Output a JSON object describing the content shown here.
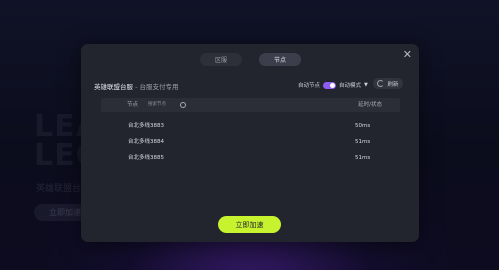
{
  "background": {
    "logo_lines": [
      "LEAGUE",
      "LEGENDS"
    ],
    "sub_text": "英雄联盟台服",
    "button_label": "立即加速"
  },
  "modal": {
    "tabs": [
      {
        "label": "区服",
        "active": false
      },
      {
        "label": "节点",
        "active": true
      }
    ],
    "title": "英雄联盟台服",
    "title_sep": " - ",
    "subtitle": "台服支付专用",
    "auto_node_label": "自动节点",
    "auto_node_on": true,
    "auto_mode_label": "自动模式",
    "refresh_label": "刷新",
    "table": {
      "col_node": "节点",
      "search_placeholder": "搜索节点",
      "col_latency": "延时/状态",
      "rows": [
        {
          "name": "台北多线3883",
          "latency": "50ms"
        },
        {
          "name": "台北多线3884",
          "latency": "51ms"
        },
        {
          "name": "台北多线3885",
          "latency": "51ms"
        }
      ]
    },
    "accelerate_label": "立即加速",
    "accent_color": "#c6f22e",
    "toggle_color": "#8d5cf0"
  }
}
